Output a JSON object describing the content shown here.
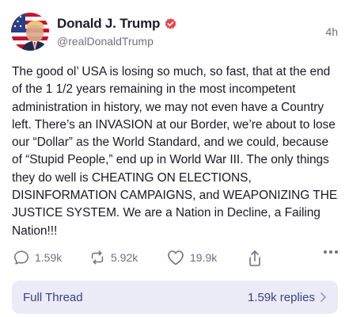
{
  "author": {
    "display_name": "Donald J. Trump",
    "handle": "@realDonaldTrump",
    "verified_badge_color": "#e5484d",
    "avatar_icon": "flag-portrait-avatar"
  },
  "post": {
    "timestamp": "4h",
    "text": "The good ol’ USA is losing so much, so fast, that at the end of the 1 1/2 years remaining in the most incompetent administration in history, we may not even have a Country left. There’s an INVASION at our Border, we’re about to lose our “Dollar” as the World Standard, and we could, because of “Stupid People,” end up in World War III. The only things they do well is CHEATING ON ELECTIONS, DISINFORMATION CAMPAIGNS, and WEAPONIZING THE JUSTICE SYSTEM. We are a Nation in Decline, a Failing Nation!!!"
  },
  "actions": {
    "replies": {
      "icon": "comment-icon",
      "count": "1.59k"
    },
    "retruths": {
      "icon": "retruth-icon",
      "count": "5.92k"
    },
    "likes": {
      "icon": "heart-icon",
      "count": "19.9k"
    },
    "share": {
      "icon": "share-icon"
    },
    "more": {
      "icon": "more-dots-icon"
    }
  },
  "thread": {
    "label": "Full Thread",
    "replies_text": "1.59k replies",
    "accent_color": "#3a3f86",
    "background_color": "#ebeaf7"
  }
}
